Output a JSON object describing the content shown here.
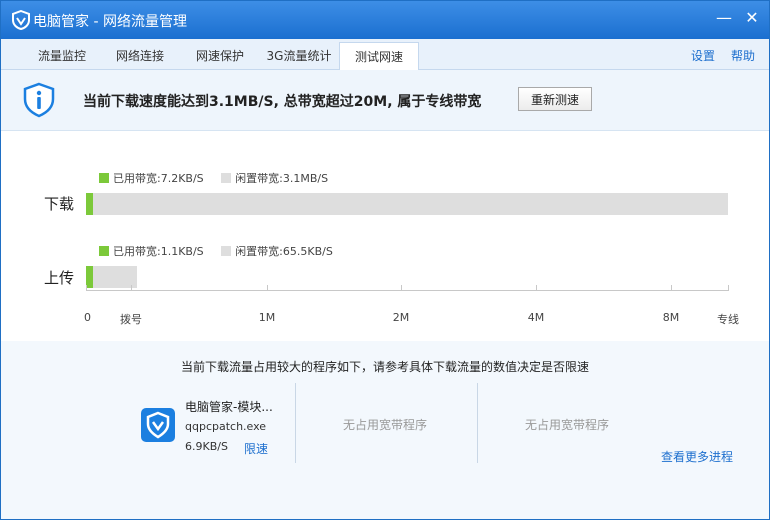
{
  "window": {
    "title": "电脑管家 - 网络流量管理",
    "minimize_glyph": "—",
    "close_glyph": "✕"
  },
  "tabs": [
    {
      "label": "流量监控",
      "active": false
    },
    {
      "label": "网络连接",
      "active": false
    },
    {
      "label": "网速保护",
      "active": false
    },
    {
      "label": "3G流量统计",
      "active": false
    },
    {
      "label": "测试网速",
      "active": true
    }
  ],
  "header_links": {
    "settings": "设置",
    "help": "帮助"
  },
  "banner": {
    "message": "当前下载速度能达到3.1MB/S, 总带宽超过20M, 属于专线带宽",
    "retest_label": "重新测速",
    "icon": "info-shield-icon"
  },
  "chart": {
    "download": {
      "label": "下载",
      "used_label": "已用带宽:7.2KB/S",
      "idle_label": "闲置带宽:3.1MB/S",
      "used_fraction": 0.0023,
      "total_fraction": 1.0
    },
    "upload": {
      "label": "上传",
      "used_label": "已用带宽:1.1KB/S",
      "idle_label": "闲置带宽:65.5KB/S",
      "used_fraction": 0.0017,
      "total_fraction": 0.08
    },
    "colors": {
      "used": "#7cc93a",
      "idle": "#dedede"
    },
    "axis_ticks": [
      "0",
      "拨号",
      "1M",
      "2M",
      "4M",
      "8M",
      "专线"
    ]
  },
  "bottom": {
    "note": "当前下载流量占用较大的程序如下，请参考具体下载流量的数值决定是否限速",
    "process": {
      "name": "电脑管家-模块...",
      "exe": "qqpcpatch.exe",
      "speed": "6.9KB/S",
      "limit_label": "限速",
      "icon": "qq-pc-manager-icon"
    },
    "empty_slot_1": "无占用宽带程序",
    "empty_slot_2": "无占用宽带程序",
    "more_label": "查看更多进程"
  }
}
